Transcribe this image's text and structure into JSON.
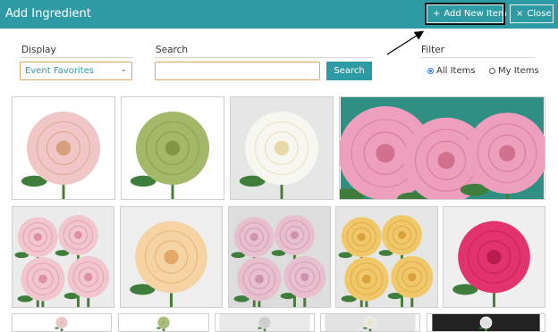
{
  "dialog": {
    "title": "Add Ingredient"
  },
  "header_buttons": {
    "add_new": {
      "icon": "plus-icon",
      "glyph": "+",
      "label": "Add New Item"
    },
    "close": {
      "icon": "close-icon",
      "glyph": "×",
      "label": "Close"
    }
  },
  "display": {
    "label": "Display",
    "selected": "Event Favorites"
  },
  "search": {
    "label": "Search",
    "value": "",
    "placeholder": "",
    "button_label": "Search"
  },
  "filter": {
    "label": "Filter",
    "options": [
      {
        "label": "All Items",
        "selected": true
      },
      {
        "label": "My Items",
        "selected": false
      }
    ]
  },
  "colors": {
    "header": "#2e9aa3",
    "accent": "#2e9aa3",
    "field_border": "#d9a66b"
  },
  "ingredients": [
    {
      "name": "Pale pink garden rose",
      "bg": "#ffffff",
      "color": "#f0c6c6",
      "center": "#d4a07e"
    },
    {
      "name": "Green rose",
      "bg": "#ffffff",
      "color": "#a3b868",
      "center": "#7f9647"
    },
    {
      "name": "White garden rose",
      "bg": "#e6e6e6",
      "color": "#f7f6f0",
      "center": "#e7d9a8"
    },
    {
      "name": "Pink garden roses on teal",
      "bg": "#2f8f83",
      "color": "#ee9fbd",
      "center": "#d2708f"
    },
    {
      "name": "Blush pink rose bunch",
      "bg": "#ececec",
      "color": "#f2c6cf",
      "center": "#dd91a2"
    },
    {
      "name": "Peach garden rose",
      "bg": "#eeeeee",
      "color": "#f5d3a2",
      "center": "#e2a969"
    },
    {
      "name": "Lavender pink rose bunch",
      "bg": "#dddddd",
      "color": "#e8bfcf",
      "center": "#cd93ae"
    },
    {
      "name": "Yellow rose bunch",
      "bg": "#e6e6e6",
      "color": "#f0c86a",
      "center": "#d9a23c"
    },
    {
      "name": "Hot pink rose",
      "bg": "#efefef",
      "color": "#e3336e",
      "center": "#b81d4f"
    },
    {
      "name": "Partial tile 1",
      "bg": "#ffffff",
      "color": "#f1d4d4",
      "center": "#ddb0b0"
    },
    {
      "name": "Partial tile 2",
      "bg": "#ffffff",
      "color": "#b9c98a",
      "center": "#92a865"
    },
    {
      "name": "Partial tile 3",
      "bg": "#e9e9e9",
      "color": "#d8d8d8",
      "center": "#c2c2c2"
    },
    {
      "name": "Partial tile 4",
      "bg": "#e3e3e3",
      "color": "#f2f1ea",
      "center": "#ddd9c4"
    },
    {
      "name": "Partial tile 5",
      "bg": "#222222",
      "color": "#efefef",
      "center": "#cfcfcf"
    }
  ]
}
